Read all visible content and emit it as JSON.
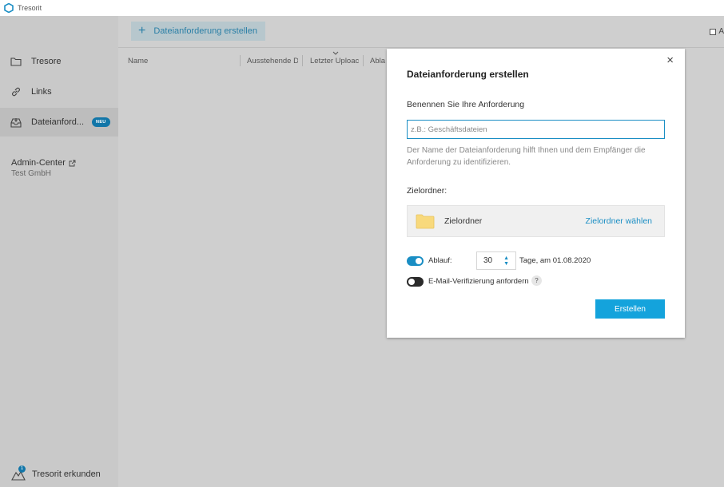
{
  "app": {
    "title": "Tresorit",
    "logo_icon": "tresorit-logo-icon"
  },
  "sidebar": {
    "items": [
      {
        "label": "Tresore",
        "icon": "folder-icon"
      },
      {
        "label": "Links",
        "icon": "link-icon"
      },
      {
        "label": "Dateianford...",
        "icon": "inbox-icon",
        "badge": "NEU",
        "active": true
      }
    ],
    "admin": {
      "label": "Admin-Center",
      "org": "Test GmbH",
      "icon": "external-link-icon"
    },
    "explore": {
      "label": "Tresorit erkunden",
      "badge_count": "1",
      "icon": "mountain-icon"
    }
  },
  "main": {
    "create_button": "Dateianforderung erstellen",
    "select_all_label": "A",
    "columns": [
      "Name",
      "Ausstehende D",
      "Letzter Uploac",
      "Abla"
    ]
  },
  "modal": {
    "title": "Dateianforderung erstellen",
    "name_label": "Benennen Sie Ihre Anforderung",
    "name_placeholder": "z.B.: Geschäftsdateien",
    "name_value": "",
    "help_text": "Der Name der Dateianforderung hilft Ihnen und dem Empfänger die Anforderung zu identifizieren.",
    "folder_label": "Zielordner:",
    "folder_name": "Zielordner",
    "folder_choose": "Zielordner wählen",
    "expiry_label": "Ablauf:",
    "expiry_days": "30",
    "expiry_text": "Tage, am 01.08.2020",
    "email_label": "E-Mail-Verifizierung anfordern",
    "help_q": "?",
    "submit": "Erstellen",
    "close": "×"
  },
  "colors": {
    "accent": "#14a3dc",
    "link": "#1a8ec4",
    "badge": "#1276a8",
    "folder": "#f8d97c"
  }
}
